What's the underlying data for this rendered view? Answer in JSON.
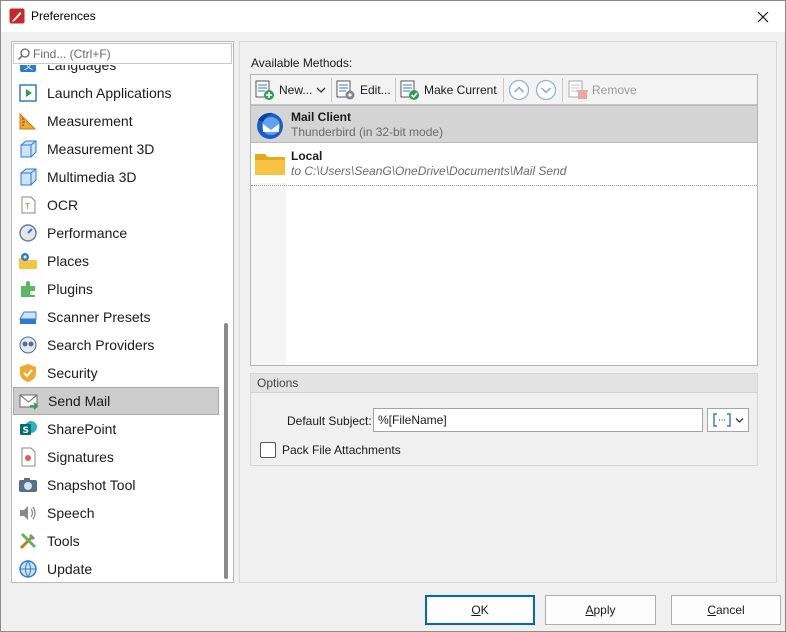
{
  "window": {
    "title": "Preferences"
  },
  "search": {
    "placeholder": "Find... (Ctrl+F)",
    "value": ""
  },
  "sidebar": {
    "items": [
      {
        "label": "Languages",
        "icon": "languages-icon"
      },
      {
        "label": "Launch Applications",
        "icon": "launch-applications-icon"
      },
      {
        "label": "Measurement",
        "icon": "measurement-icon"
      },
      {
        "label": "Measurement 3D",
        "icon": "measurement-3d-icon"
      },
      {
        "label": "Multimedia 3D",
        "icon": "multimedia-3d-icon"
      },
      {
        "label": "OCR",
        "icon": "ocr-icon"
      },
      {
        "label": "Performance",
        "icon": "performance-icon"
      },
      {
        "label": "Places",
        "icon": "places-icon"
      },
      {
        "label": "Plugins",
        "icon": "plugins-icon"
      },
      {
        "label": "Scanner Presets",
        "icon": "scanner-presets-icon"
      },
      {
        "label": "Search Providers",
        "icon": "search-providers-icon"
      },
      {
        "label": "Security",
        "icon": "security-icon"
      },
      {
        "label": "Send Mail",
        "icon": "send-mail-icon"
      },
      {
        "label": "SharePoint",
        "icon": "sharepoint-icon"
      },
      {
        "label": "Signatures",
        "icon": "signatures-icon"
      },
      {
        "label": "Snapshot Tool",
        "icon": "snapshot-tool-icon"
      },
      {
        "label": "Speech",
        "icon": "speech-icon"
      },
      {
        "label": "Tools",
        "icon": "tools-icon"
      },
      {
        "label": "Update",
        "icon": "update-icon"
      }
    ],
    "selected": "Send Mail"
  },
  "methods": {
    "section_label": "Available Methods:",
    "toolbar": {
      "new_label": "New...",
      "edit_label": "Edit...",
      "make_current_label": "Make Current",
      "remove_label": "Remove"
    },
    "rows": [
      {
        "name": "Mail Client",
        "description": "Thunderbird (in 32-bit mode)",
        "icon": "thunderbird-icon"
      },
      {
        "name": "Local",
        "description": "to C:\\Users\\SeanG\\OneDrive\\Documents\\Mail Send",
        "icon": "folder-icon"
      }
    ]
  },
  "options": {
    "title": "Options",
    "default_subject_label": "Default Subject:",
    "default_subject_value": "%[FileName]",
    "pack_attachments_label": "Pack File Attachments",
    "pack_attachments_checked": false
  },
  "buttons": {
    "ok": "OK",
    "apply": "Apply",
    "cancel": "Cancel"
  },
  "colors": {
    "accent": "#0067c0",
    "selection": "#cccccc"
  }
}
